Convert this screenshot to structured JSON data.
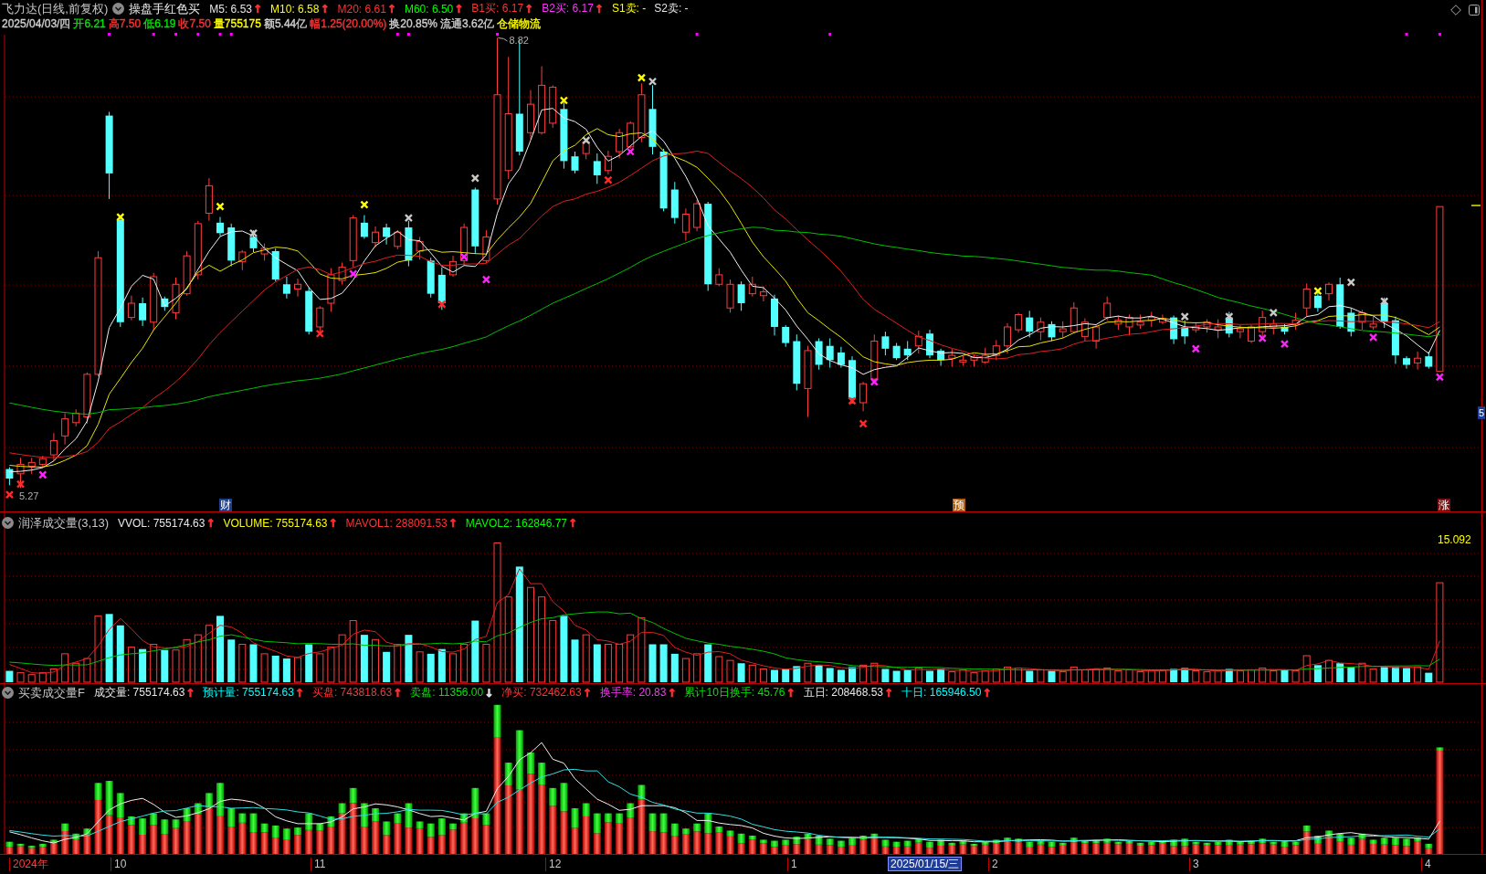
{
  "price_header": {
    "title": "飞力达(日线,前复权)",
    "formula": "操盘手红色买",
    "indicators": [
      {
        "text": "M5: 6.53",
        "color": "#e8e8e8",
        "arrow": {
          "text": "↑",
          "color": "#ff3030"
        }
      },
      {
        "text": "M10: 6.58",
        "color": "#ffff00",
        "arrow": {
          "text": "↑",
          "color": "#ff3030"
        }
      },
      {
        "text": "M20: 6.61",
        "color": "#ff3333",
        "arrow": {
          "text": "↑",
          "color": "#ff3030"
        }
      },
      {
        "text": "M60: 6.50",
        "color": "#00ff00",
        "arrow": {
          "text": "↑",
          "color": "#ff3030"
        }
      },
      {
        "text": "B1买: 6.17",
        "color": "#ff3333",
        "arrow": {
          "text": "↑",
          "color": "#ff3030"
        }
      },
      {
        "text": "B2买: 6.17",
        "color": "#ff33ff",
        "arrow": {
          "text": "↑",
          "color": "#ff3030"
        }
      },
      {
        "text": "S1卖: -",
        "color": "#ffff00"
      },
      {
        "text": "S2卖: -",
        "color": "#e8e8e8"
      }
    ],
    "quote": [
      {
        "text": "2025/04/03/四",
        "color": "#d0d0d0"
      },
      {
        "text": "开6.21",
        "color": "#00e600"
      },
      {
        "text": "高7.50",
        "color": "#ff3333"
      },
      {
        "text": "低6.19",
        "color": "#00e600"
      },
      {
        "text": "收7.50",
        "color": "#ff3333"
      },
      {
        "text": "量755175",
        "color": "#ffff00"
      },
      {
        "text": "额5.44亿",
        "color": "#d0d0d0"
      },
      {
        "text": "幅1.25(20.00%)",
        "color": "#ff3333"
      },
      {
        "text": "换20.85%",
        "color": "#d0d0d0"
      },
      {
        "text": "流通3.62亿",
        "color": "#d0d0d0"
      },
      {
        "text": "仓储物流",
        "color": "#ffff00"
      }
    ]
  },
  "price_chart": {
    "high_label": "8.82",
    "low_label": "5.27",
    "event_tags": [
      {
        "text": "财",
        "color": "#1d3f8f"
      },
      {
        "text": "预",
        "color": "#b06010"
      },
      {
        "text": "涨",
        "color": "#7a1010"
      }
    ],
    "edge_tag": "5"
  },
  "volume_panel": {
    "title": "润泽成交量(3,13)",
    "indicators": [
      {
        "text": "VVOL: 755174.63",
        "color": "#e8e8e8",
        "arrow": {
          "text": "↑",
          "color": "#ff3030"
        }
      },
      {
        "text": "VOLUME: 755174.63",
        "color": "#ffff00",
        "arrow": {
          "text": "↑",
          "color": "#ff3030"
        }
      },
      {
        "text": "MAVOL1: 288091.53",
        "color": "#ff3333",
        "arrow": {
          "text": "↑",
          "color": "#ff3030"
        }
      },
      {
        "text": "MAVOL2: 162846.77",
        "color": "#00ff00",
        "arrow": {
          "text": "↑",
          "color": "#ff3030"
        }
      }
    ],
    "scale_label": "15.092"
  },
  "flow_panel": {
    "title": "买卖成交量F",
    "indicators": [
      {
        "text": "成交量: 755174.63",
        "color": "#e8e8e8",
        "arrow": {
          "text": "↑",
          "color": "#ff3030"
        }
      },
      {
        "text": "预计量: 755174.63",
        "color": "#00ffff",
        "arrow": {
          "text": "↑",
          "color": "#ff3030"
        }
      },
      {
        "text": "买盘: 743818.63",
        "color": "#ff3333",
        "arrow": {
          "text": "↑",
          "color": "#ff3030"
        }
      },
      {
        "text": "卖盘: 11356.00",
        "color": "#00e600",
        "arrow": {
          "text": "↓",
          "color": "#e0e0e0"
        }
      },
      {
        "text": "净买: 732462.63",
        "color": "#ff3333",
        "arrow": {
          "text": "↑",
          "color": "#ff3030"
        }
      },
      {
        "text": "换手率: 20.83",
        "color": "#ff33ff",
        "arrow": {
          "text": "↑",
          "color": "#ff3030"
        }
      },
      {
        "text": "累计10日换手: 45.76",
        "color": "#00e600",
        "arrow": {
          "text": "↑",
          "color": "#ff3030"
        }
      },
      {
        "text": "五日: 208468.53",
        "color": "#e8e8e8",
        "arrow": {
          "text": "↑",
          "color": "#ff3030"
        }
      },
      {
        "text": "十日: 165946.50",
        "color": "#00ffff",
        "arrow": {
          "text": "↑",
          "color": "#ff3030"
        }
      }
    ]
  },
  "x_axis": {
    "labels": [
      {
        "text": "2024年",
        "color": "#ff4040"
      },
      {
        "text": "10",
        "color": "#c8c8c8"
      },
      {
        "text": "11",
        "color": "#c8c8c8"
      },
      {
        "text": "12",
        "color": "#c8c8c8"
      },
      {
        "text": "1",
        "color": "#c8c8c8"
      },
      {
        "text": "2",
        "color": "#c8c8c8"
      },
      {
        "text": "3",
        "color": "#c8c8c8"
      },
      {
        "text": "4",
        "color": "#c8c8c8"
      }
    ],
    "cursor_date": "2025/01/15/三"
  }
}
